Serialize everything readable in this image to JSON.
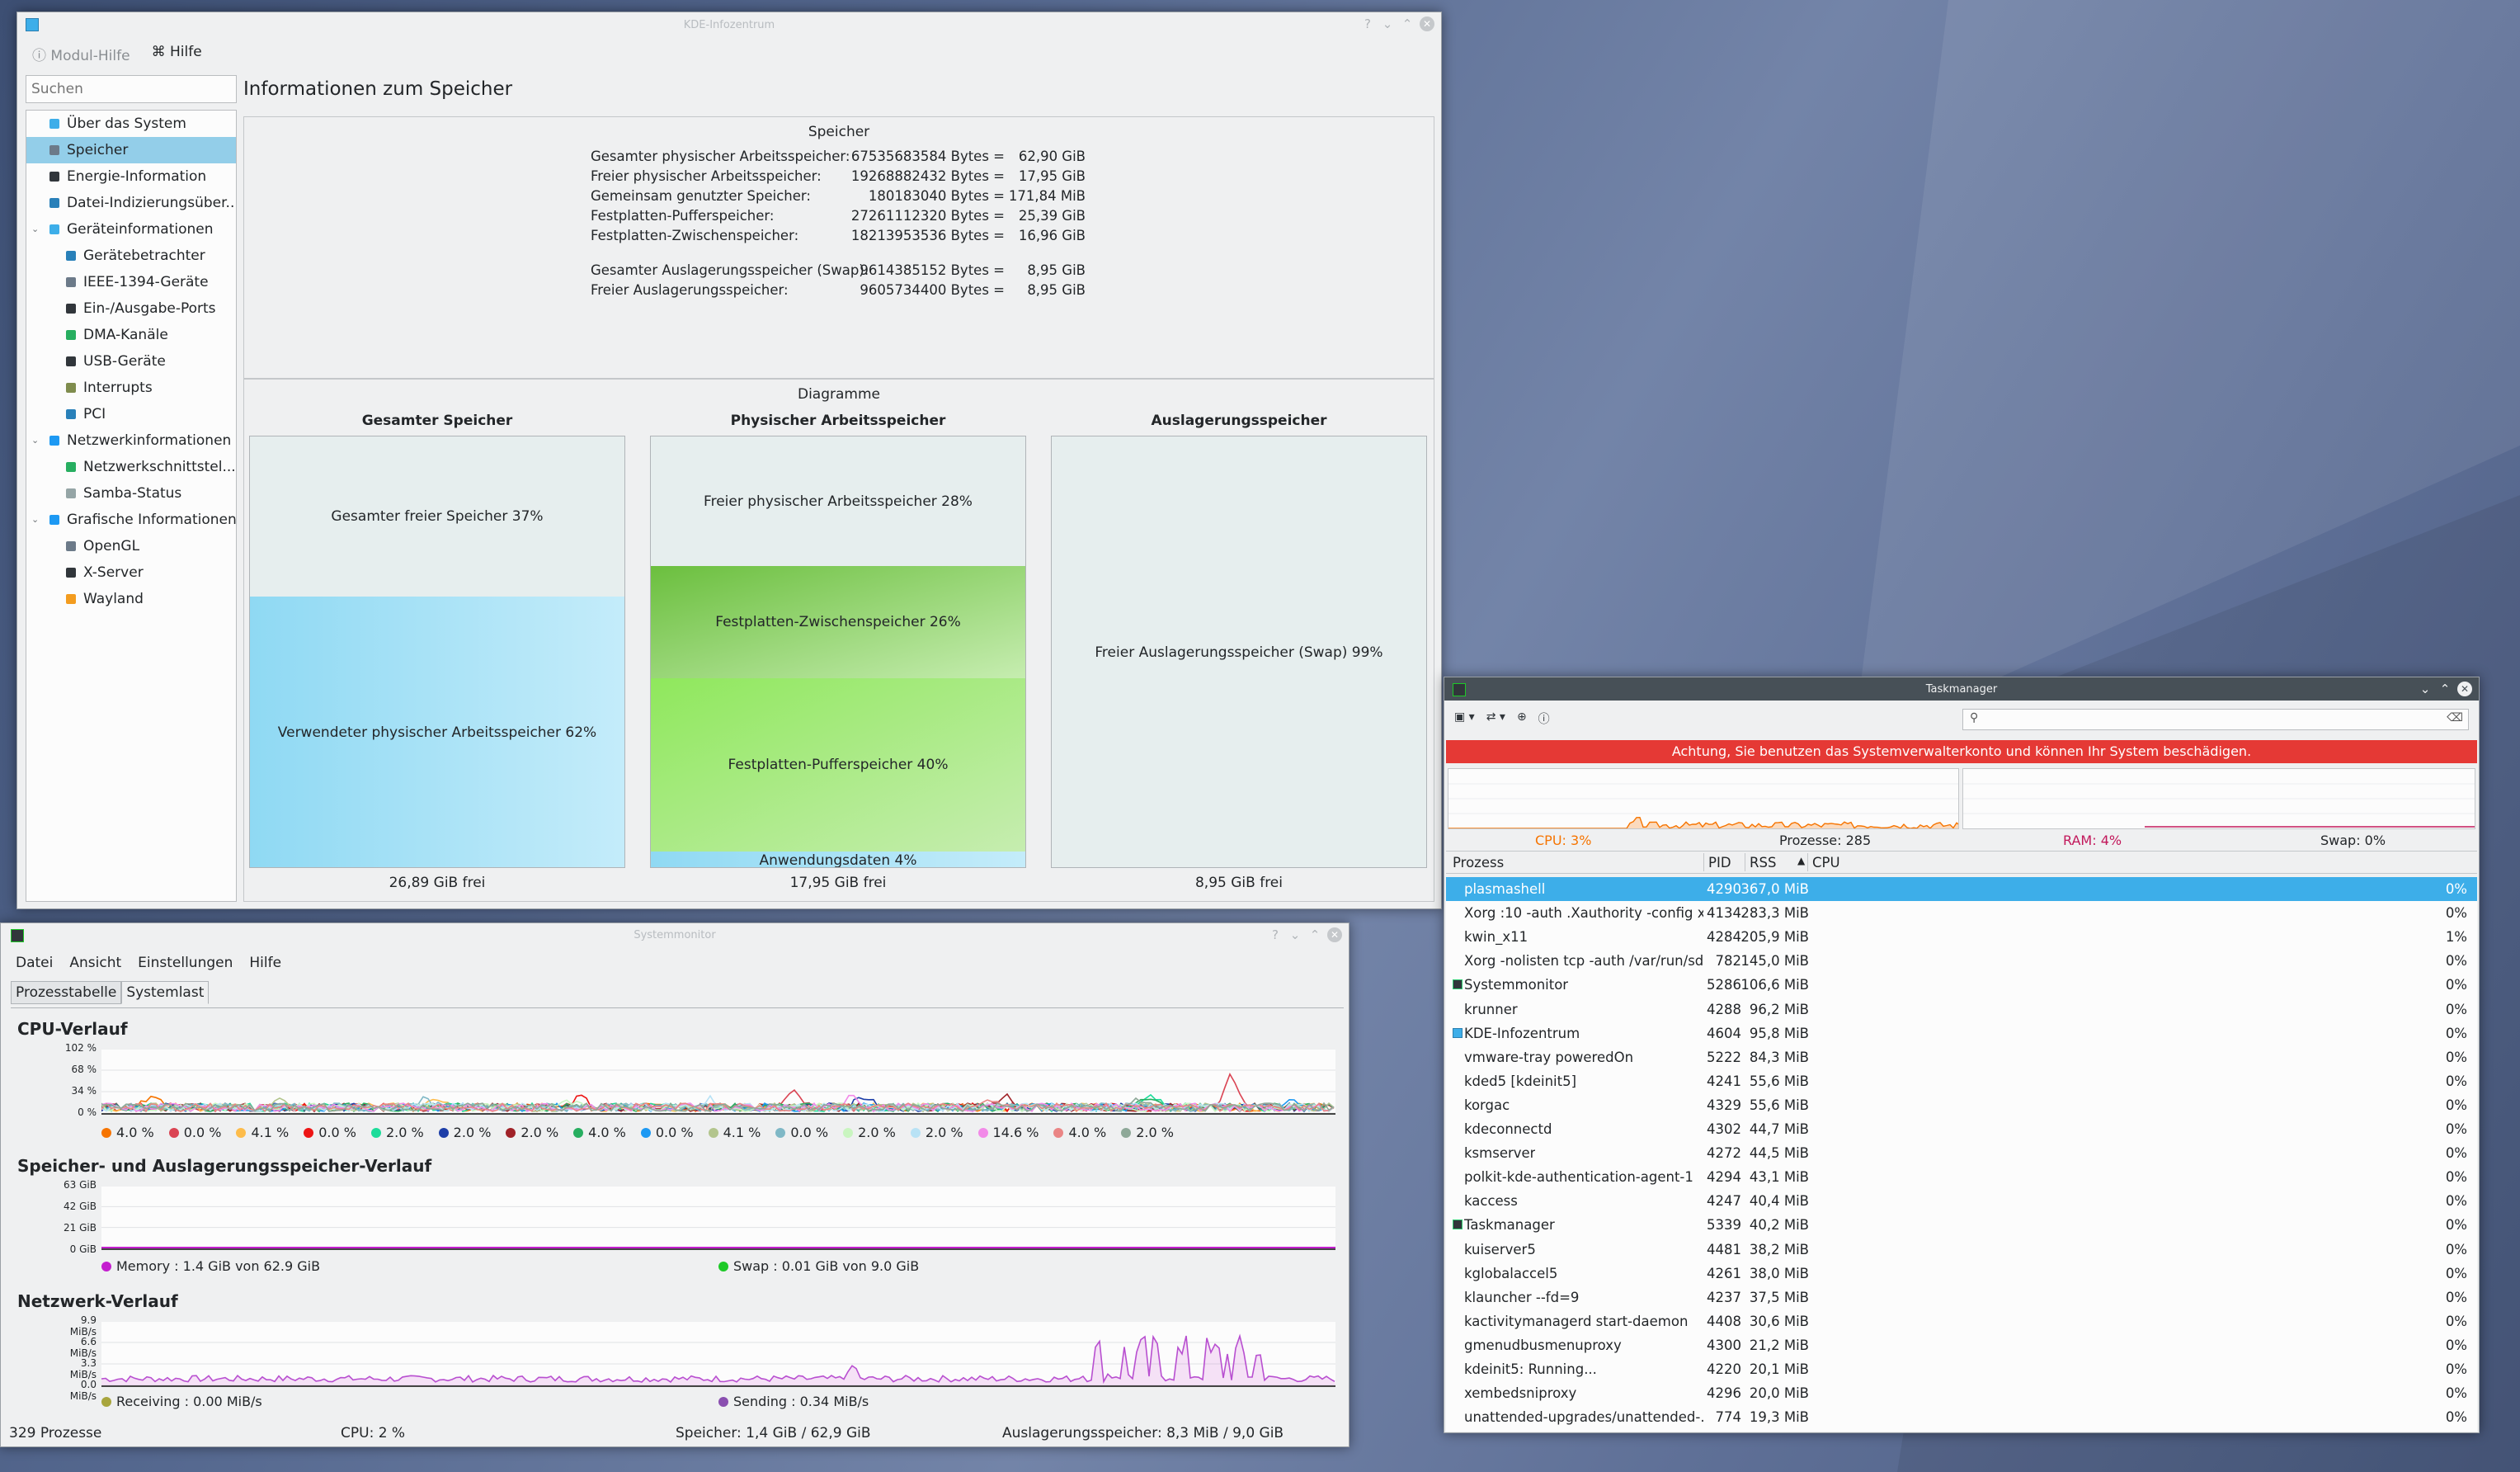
{
  "kinfo": {
    "window_title": "KDE-Infozentrum",
    "menu": {
      "module_help": "Modul-Hilfe",
      "help": "Hilfe"
    },
    "search_placeholder": "Suchen",
    "page_title": "Informationen zum Speicher",
    "sidebar": [
      {
        "label": "Über das System",
        "level": 0,
        "color": "#3daee9"
      },
      {
        "label": "Speicher",
        "level": 0,
        "selected": true,
        "color": "#6c7a89"
      },
      {
        "label": "Energie-Information",
        "level": 0,
        "color": "#31363b"
      },
      {
        "label": "Datei-Indizierungsüber...",
        "level": 0,
        "color": "#2980b9"
      },
      {
        "label": "Geräteinformationen",
        "level": 0,
        "expanded": true,
        "color": "#3daee9"
      },
      {
        "label": "Gerätebetrachter",
        "level": 1,
        "color": "#2980b9"
      },
      {
        "label": "IEEE-1394-Geräte",
        "level": 1,
        "color": "#6c7a89"
      },
      {
        "label": "Ein-/Ausgabe-Ports",
        "level": 1,
        "color": "#31363b"
      },
      {
        "label": "DMA-Kanäle",
        "level": 1,
        "color": "#27ae60"
      },
      {
        "label": "USB-Geräte",
        "level": 1,
        "color": "#31363b"
      },
      {
        "label": "Interrupts",
        "level": 1,
        "color": "#7f8c4d"
      },
      {
        "label": "PCI",
        "level": 1,
        "color": "#2980b9"
      },
      {
        "label": "Netzwerkinformationen",
        "level": 0,
        "expanded": true,
        "color": "#1d99f3"
      },
      {
        "label": "Netzwerkschnittstel...",
        "level": 1,
        "color": "#27ae60"
      },
      {
        "label": "Samba-Status",
        "level": 1,
        "color": "#95a5a6"
      },
      {
        "label": "Grafische Informationen",
        "level": 0,
        "expanded": true,
        "color": "#1d99f3"
      },
      {
        "label": "OpenGL",
        "level": 1,
        "color": "#6c7a89"
      },
      {
        "label": "X-Server",
        "level": 1,
        "color": "#31363b"
      },
      {
        "label": "Wayland",
        "level": 1,
        "color": "#f39c1f"
      }
    ],
    "memory": {
      "heading": "Speicher",
      "rows": [
        {
          "label": "Gesamter physischer Arbeitsspeicher:",
          "bytes": "67535683584 Bytes =",
          "size": "62,90 GiB"
        },
        {
          "label": "Freier physischer Arbeitsspeicher:",
          "bytes": "19268882432 Bytes =",
          "size": "17,95 GiB"
        },
        {
          "label": "Gemeinsam genutzter Speicher:",
          "bytes": "180183040 Bytes =",
          "size": "171,84 MiB"
        },
        {
          "label": "Festplatten-Pufferspeicher:",
          "bytes": "27261112320 Bytes =",
          "size": "25,39 GiB"
        },
        {
          "label": "Festplatten-Zwischenspeicher:",
          "bytes": "18213953536 Bytes =",
          "size": "16,96 GiB"
        },
        {
          "label": "Gesamter Auslagerungsspeicher (Swap):",
          "bytes": "9614385152 Bytes =",
          "size": "8,95 GiB"
        },
        {
          "label": "Freier Auslagerungsspeicher:",
          "bytes": "9605734400 Bytes =",
          "size": "8,95 GiB"
        }
      ]
    },
    "diagrams": {
      "heading": "Diagramme",
      "charts": [
        {
          "title": "Gesamter Speicher",
          "footer": "26,89 GiB frei",
          "segments": [
            {
              "label": "Gesamter freier Speicher 37%",
              "percent": 37,
              "color": "#e4ecec"
            },
            {
              "label": "Verwendeter physischer Arbeitsspeicher 62%",
              "percent": 63,
              "color": "#8fd9f3"
            }
          ]
        },
        {
          "title": "Physischer Arbeitsspeicher",
          "footer": "17,95 GiB frei",
          "segments": [
            {
              "label": "Freier physischer Arbeitsspeicher 28%",
              "percent": 30,
              "color": "#e4ecec"
            },
            {
              "label": "Festplatten-Zwischenspeicher 26%",
              "percent": 26,
              "color": "#6bbf3e"
            },
            {
              "label": "Festplatten-Pufferspeicher 40%",
              "percent": 40,
              "color": "#8fe85c"
            },
            {
              "label": "Anwendungsdaten 4%",
              "percent": 4,
              "color": "#8fd9f3"
            }
          ]
        },
        {
          "title": "Auslagerungsspeicher",
          "footer": "8,95 GiB frei",
          "segments": [
            {
              "label": "Freier Auslagerungsspeicher (Swap) 99%",
              "percent": 100,
              "color": "#e4ecec"
            }
          ]
        }
      ]
    }
  },
  "sysmon": {
    "window_title": "Systemmonitor",
    "menu": [
      "Datei",
      "Ansicht",
      "Einstellungen",
      "Hilfe"
    ],
    "tabs": [
      "Prozesstabelle",
      "Systemlast"
    ],
    "cpu": {
      "title": "CPU-Verlauf",
      "yticks": [
        "102 %",
        "68 %",
        "34 %",
        "0 %"
      ],
      "legend": [
        {
          "value": "4.0 %",
          "color": "#f67400"
        },
        {
          "value": "0.0 %",
          "color": "#da4453"
        },
        {
          "value": "4.1 %",
          "color": "#fdbc4b"
        },
        {
          "value": "0.0 %",
          "color": "#ed1515"
        },
        {
          "value": "2.0 %",
          "color": "#1cdc9a"
        },
        {
          "value": "2.0 %",
          "color": "#1d3ea8"
        },
        {
          "value": "2.0 %",
          "color": "#a02228"
        },
        {
          "value": "4.0 %",
          "color": "#27ae60"
        },
        {
          "value": "0.0 %",
          "color": "#1d99f3"
        },
        {
          "value": "4.1 %",
          "color": "#b3c58d"
        },
        {
          "value": "0.0 %",
          "color": "#7fb8c6"
        },
        {
          "value": "2.0 %",
          "color": "#c9f5c0"
        },
        {
          "value": "2.0 %",
          "color": "#b8e2f5"
        },
        {
          "value": "14.6 %",
          "color": "#f28ae8"
        },
        {
          "value": "4.0 %",
          "color": "#ea8585"
        },
        {
          "value": "2.0 %",
          "color": "#8ea898"
        }
      ]
    },
    "mem": {
      "title": "Speicher- und Auslagerungsspeicher-Verlauf",
      "yticks": [
        "63 GiB",
        "42 GiB",
        "21 GiB",
        "0 GiB"
      ],
      "legend": [
        {
          "label": "Memory : 1.4 GiB von 62.9 GiB",
          "color": "#c41ecf"
        },
        {
          "label": "Swap : 0.01 GiB von 9.0 GiB",
          "color": "#1ec928"
        }
      ]
    },
    "net": {
      "title": "Netzwerk-Verlauf",
      "yticks": [
        "9.9 MiB/s",
        "6.6 MiB/s",
        "3.3 MiB/s",
        "0.0 MiB/s"
      ],
      "legend": [
        {
          "label": "Receiving : 0.00 MiB/s",
          "color": "#a8a53d"
        },
        {
          "label": "Sending : 0.34 MiB/s",
          "color": "#8a4fb0"
        }
      ]
    },
    "status": {
      "processes": "329 Prozesse",
      "cpu": "CPU: 2 %",
      "memory": "Speicher: 1,4 GiB / 62,9 GiB",
      "swap": "Auslagerungsspeicher: 8,3 MiB / 9,0 GiB"
    }
  },
  "taskmgr": {
    "window_title": "Taskmanager",
    "warning": "Achtung, Sie benutzen das Systemverwalterkonto und können Ihr System beschädigen.",
    "stats": {
      "cpu": "CPU: 3%",
      "processes": "Prozesse: 285",
      "ram": "RAM: 4%",
      "swap": "Swap: 0%"
    },
    "columns": [
      "Prozess",
      "PID",
      "RSS",
      "CPU"
    ],
    "rows": [
      {
        "name": "plasmashell",
        "pid": "4290",
        "rss": "367,0 MiB",
        "cpu": "0%",
        "selected": true
      },
      {
        "name": "Xorg :10 -auth .Xauthority -config x...",
        "pid": "4134",
        "rss": "283,3 MiB",
        "cpu": "0%"
      },
      {
        "name": "kwin_x11",
        "pid": "4284",
        "rss": "205,9 MiB",
        "cpu": "1%"
      },
      {
        "name": "Xorg -nolisten tcp -auth /var/run/sd...",
        "pid": "782",
        "rss": "145,0 MiB",
        "cpu": "0%"
      },
      {
        "name": "Systemmonitor",
        "pid": "5286",
        "rss": "106,6 MiB",
        "cpu": "0%",
        "icon": "dark"
      },
      {
        "name": "krunner",
        "pid": "4288",
        "rss": "96,2 MiB",
        "cpu": "0%"
      },
      {
        "name": "KDE-Infozentrum",
        "pid": "4604",
        "rss": "95,8 MiB",
        "cpu": "0%",
        "icon": "blue"
      },
      {
        "name": "vmware-tray poweredOn",
        "pid": "5222",
        "rss": "84,3 MiB",
        "cpu": "0%"
      },
      {
        "name": "kded5 [kdeinit5]",
        "pid": "4241",
        "rss": "55,6 MiB",
        "cpu": "0%"
      },
      {
        "name": "korgac",
        "pid": "4329",
        "rss": "55,6 MiB",
        "cpu": "0%"
      },
      {
        "name": "kdeconnectd",
        "pid": "4302",
        "rss": "44,7 MiB",
        "cpu": "0%"
      },
      {
        "name": "ksmserver",
        "pid": "4272",
        "rss": "44,5 MiB",
        "cpu": "0%"
      },
      {
        "name": "polkit-kde-authentication-agent-1",
        "pid": "4294",
        "rss": "43,1 MiB",
        "cpu": "0%"
      },
      {
        "name": "kaccess",
        "pid": "4247",
        "rss": "40,4 MiB",
        "cpu": "0%"
      },
      {
        "name": "Taskmanager",
        "pid": "5339",
        "rss": "40,2 MiB",
        "cpu": "0%",
        "icon": "dark"
      },
      {
        "name": "kuiserver5",
        "pid": "4481",
        "rss": "38,2 MiB",
        "cpu": "0%"
      },
      {
        "name": "kglobalaccel5",
        "pid": "4261",
        "rss": "38,0 MiB",
        "cpu": "0%"
      },
      {
        "name": "klauncher --fd=9",
        "pid": "4237",
        "rss": "37,5 MiB",
        "cpu": "0%"
      },
      {
        "name": "kactivitymanagerd start-daemon",
        "pid": "4408",
        "rss": "30,6 MiB",
        "cpu": "0%"
      },
      {
        "name": "gmenudbusmenuproxy",
        "pid": "4300",
        "rss": "21,2 MiB",
        "cpu": "0%"
      },
      {
        "name": "kdeinit5: Running...",
        "pid": "4220",
        "rss": "20,1 MiB",
        "cpu": "0%"
      },
      {
        "name": "xembedsniproxy",
        "pid": "4296",
        "rss": "20,0 MiB",
        "cpu": "0%"
      },
      {
        "name": "unattended-upgrades/unattended-...",
        "pid": "774",
        "rss": "19,3 MiB",
        "cpu": "0%"
      }
    ]
  }
}
